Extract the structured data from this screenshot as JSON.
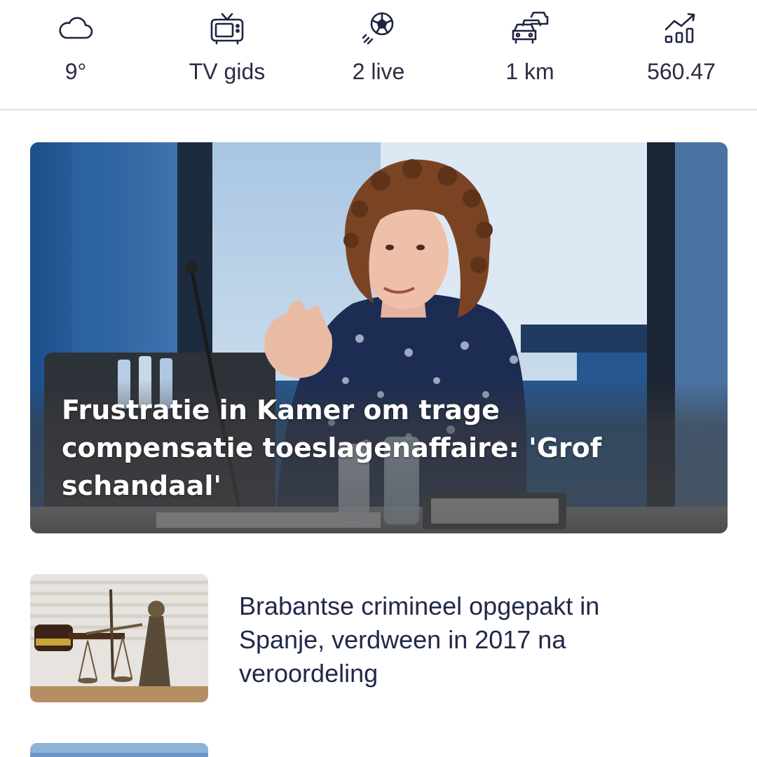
{
  "widgets": [
    {
      "icon": "cloud-icon",
      "label": "9°"
    },
    {
      "icon": "tv-icon",
      "label": "TV gids"
    },
    {
      "icon": "soccer-ball-icon",
      "label": "2 live"
    },
    {
      "icon": "traffic-cars-icon",
      "label": "1 km"
    },
    {
      "icon": "stock-chart-icon",
      "label": "560.47"
    }
  ],
  "hero": {
    "title": "Frustratie in Kamer om trage compensatie toeslagenaffaire: 'Grof schandaal'",
    "image": "photo of woman speaking in parliamentary committee room"
  },
  "articles": [
    {
      "title": "Brabantse crimineel opgepakt in Spanje, verdween in 2017 na veroordeling",
      "image": "lady justice statue with gavel"
    }
  ],
  "colors": {
    "text_primary": "#22284a",
    "icon_stroke": "#1f2440",
    "divider": "#e9e9ee",
    "hero_title": "#ffffff"
  }
}
